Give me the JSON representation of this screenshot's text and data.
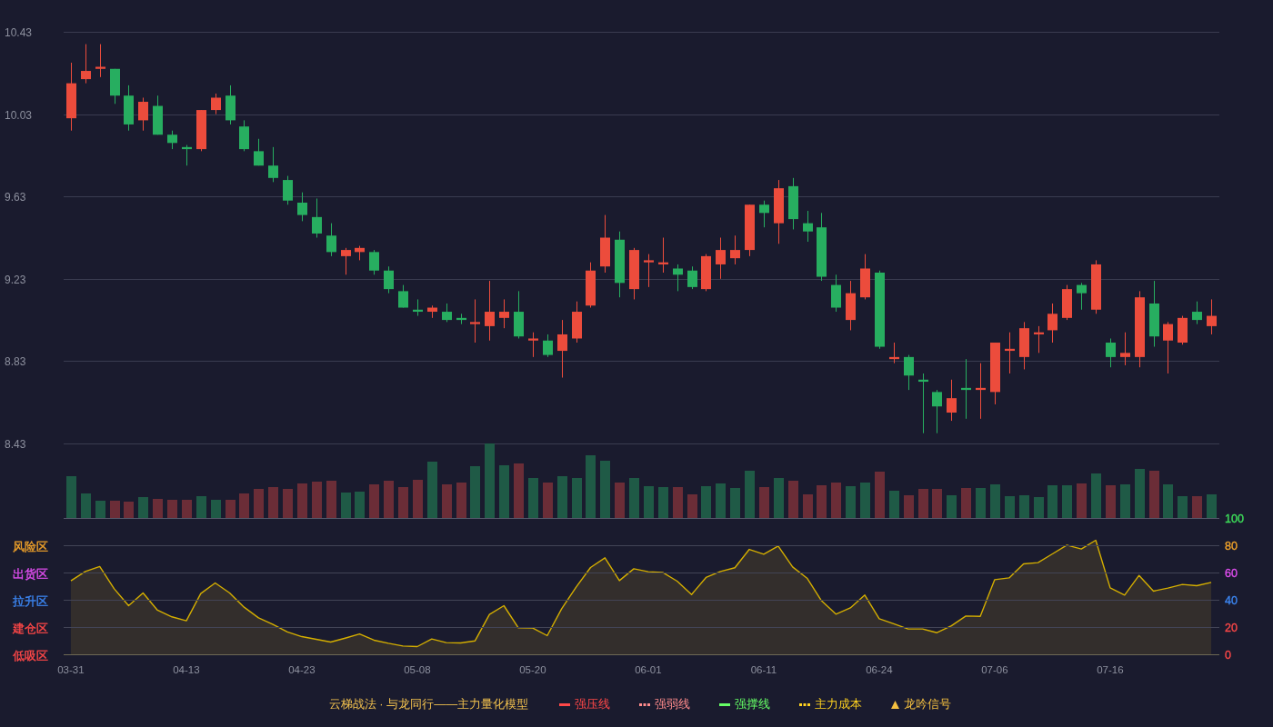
{
  "price_chart": {
    "chart_data": {
      "type": "candlestick",
      "categories": [
        null,
        null,
        null,
        null,
        null,
        null,
        null,
        null,
        null,
        null,
        null,
        null,
        null,
        null,
        null,
        null,
        null,
        null,
        null,
        null,
        null,
        null,
        null,
        null,
        null,
        null,
        null,
        null,
        null,
        null,
        null,
        null,
        null,
        null,
        null,
        null,
        null,
        null,
        null,
        null,
        null,
        null,
        null,
        null,
        null,
        null,
        null,
        null,
        null,
        null,
        null,
        null,
        null,
        null,
        null,
        null,
        null,
        null,
        null,
        null,
        null,
        null,
        null,
        null,
        null,
        null,
        null,
        null,
        null,
        null,
        null,
        null,
        null,
        null,
        null,
        null,
        null,
        null,
        null,
        null
      ],
      "ylim": [
        8.43,
        10.43
      ],
      "yticks": [
        10.43,
        10.03,
        9.63,
        9.23,
        8.83,
        8.43
      ],
      "grid": true,
      "ohlc": [
        [
          10.01,
          10.28,
          9.95,
          10.18
        ],
        [
          10.2,
          10.37,
          10.18,
          10.24
        ],
        [
          10.25,
          10.37,
          10.21,
          10.26
        ],
        [
          10.25,
          10.25,
          10.08,
          10.12
        ],
        [
          10.12,
          10.17,
          9.95,
          9.98
        ],
        [
          10.0,
          10.11,
          9.95,
          10.09
        ],
        [
          10.07,
          10.12,
          9.93,
          9.93
        ],
        [
          9.93,
          9.95,
          9.86,
          9.89
        ],
        [
          9.87,
          9.88,
          9.78,
          9.86
        ],
        [
          9.86,
          10.05,
          9.85,
          10.05
        ],
        [
          10.05,
          10.13,
          10.03,
          10.11
        ],
        [
          10.12,
          10.17,
          9.98,
          10.0
        ],
        [
          9.97,
          10.0,
          9.85,
          9.86
        ],
        [
          9.85,
          9.91,
          9.78,
          9.78
        ],
        [
          9.78,
          9.87,
          9.7,
          9.72
        ],
        [
          9.71,
          9.73,
          9.59,
          9.61
        ],
        [
          9.6,
          9.65,
          9.51,
          9.54
        ],
        [
          9.53,
          9.62,
          9.43,
          9.45
        ],
        [
          9.44,
          9.5,
          9.34,
          9.36
        ],
        [
          9.34,
          9.38,
          9.25,
          9.37
        ],
        [
          9.36,
          9.39,
          9.32,
          9.38
        ],
        [
          9.36,
          9.37,
          9.25,
          9.27
        ],
        [
          9.27,
          9.29,
          9.16,
          9.18
        ],
        [
          9.17,
          9.2,
          9.09,
          9.09
        ],
        [
          9.08,
          9.13,
          9.05,
          9.07
        ],
        [
          9.07,
          9.1,
          9.04,
          9.09
        ],
        [
          9.07,
          9.11,
          9.02,
          9.03
        ],
        [
          9.04,
          9.06,
          9.01,
          9.03
        ],
        [
          9.01,
          9.13,
          8.92,
          9.02
        ],
        [
          9.0,
          9.22,
          8.93,
          9.07
        ],
        [
          9.04,
          9.13,
          8.99,
          9.07
        ],
        [
          9.07,
          9.17,
          8.94,
          8.95
        ],
        [
          8.93,
          8.97,
          8.85,
          8.94
        ],
        [
          8.93,
          8.96,
          8.85,
          8.86
        ],
        [
          8.88,
          9.03,
          8.75,
          8.96
        ],
        [
          8.94,
          9.12,
          8.92,
          9.07
        ],
        [
          9.1,
          9.31,
          9.09,
          9.27
        ],
        [
          9.29,
          9.54,
          9.26,
          9.43
        ],
        [
          9.42,
          9.46,
          9.14,
          9.21
        ],
        [
          9.18,
          9.38,
          9.13,
          9.37
        ],
        [
          9.31,
          9.35,
          9.19,
          9.32
        ],
        [
          9.3,
          9.43,
          9.26,
          9.31
        ],
        [
          9.28,
          9.3,
          9.17,
          9.25
        ],
        [
          9.27,
          9.29,
          9.18,
          9.19
        ],
        [
          9.18,
          9.35,
          9.17,
          9.34
        ],
        [
          9.3,
          9.43,
          9.23,
          9.37
        ],
        [
          9.33,
          9.44,
          9.3,
          9.37
        ],
        [
          9.37,
          9.59,
          9.34,
          9.59
        ],
        [
          9.59,
          9.61,
          9.48,
          9.55
        ],
        [
          9.5,
          9.71,
          9.4,
          9.67
        ],
        [
          9.68,
          9.72,
          9.47,
          9.52
        ],
        [
          9.5,
          9.56,
          9.41,
          9.46
        ],
        [
          9.48,
          9.55,
          9.22,
          9.24
        ],
        [
          9.2,
          9.25,
          9.07,
          9.09
        ],
        [
          9.03,
          9.22,
          8.98,
          9.16
        ],
        [
          9.14,
          9.35,
          9.13,
          9.28
        ],
        [
          9.26,
          9.27,
          8.89,
          8.9
        ],
        [
          8.84,
          8.92,
          8.82,
          8.85
        ],
        [
          8.85,
          8.86,
          8.69,
          8.76
        ],
        [
          8.74,
          8.77,
          8.48,
          8.73
        ],
        [
          8.68,
          8.69,
          8.48,
          8.61
        ],
        [
          8.58,
          8.74,
          8.54,
          8.65
        ],
        [
          8.7,
          8.84,
          8.55,
          8.69
        ],
        [
          8.69,
          8.82,
          8.55,
          8.7
        ],
        [
          8.68,
          8.92,
          8.62,
          8.92
        ],
        [
          8.88,
          8.97,
          8.77,
          8.89
        ],
        [
          8.85,
          9.02,
          8.79,
          8.99
        ],
        [
          8.96,
          9.0,
          8.87,
          8.97
        ],
        [
          8.98,
          9.11,
          8.92,
          9.06
        ],
        [
          9.04,
          9.2,
          9.03,
          9.18
        ],
        [
          9.2,
          9.21,
          9.08,
          9.16
        ],
        [
          9.08,
          9.32,
          9.06,
          9.3
        ],
        [
          8.92,
          8.94,
          8.8,
          8.85
        ],
        [
          8.85,
          8.97,
          8.81,
          8.87
        ],
        [
          8.85,
          9.17,
          8.8,
          9.14
        ],
        [
          9.11,
          9.22,
          8.9,
          8.95
        ],
        [
          8.93,
          9.02,
          8.77,
          9.01
        ],
        [
          8.92,
          9.05,
          8.91,
          9.04
        ],
        [
          9.07,
          9.12,
          9.01,
          9.03
        ],
        [
          9.0,
          9.13,
          8.96,
          9.05
        ]
      ]
    }
  },
  "indicator": {
    "zones": [
      {
        "label": "风险区",
        "color": "#f2a32a"
      },
      {
        "label": "出货区",
        "color": "#e04ef0"
      },
      {
        "label": "拉升区",
        "color": "#3c86f2"
      },
      {
        "label": "建仓区",
        "color": "#ff4848"
      },
      {
        "label": "低吸区",
        "color": "#ff4848"
      }
    ],
    "right_axis": [
      {
        "color": "#3ee05a"
      },
      {
        "color": "#f2a32a"
      },
      {
        "color": "#e04ef0"
      },
      {
        "color": "#3c86f2"
      },
      {
        "color": "#ff4848"
      },
      {
        "color": "#ff4848"
      }
    ],
    "chart_data": {
      "type": "area",
      "categories": [
        "03-31",
        null,
        null,
        null,
        null,
        null,
        null,
        null,
        "04-13",
        null,
        null,
        null,
        null,
        null,
        null,
        null,
        "04-23",
        null,
        null,
        null,
        null,
        null,
        null,
        null,
        "05-08",
        null,
        null,
        null,
        null,
        null,
        null,
        null,
        "05-20",
        null,
        null,
        null,
        null,
        null,
        null,
        null,
        "06-01",
        null,
        null,
        null,
        null,
        null,
        null,
        null,
        "06-11",
        null,
        null,
        null,
        null,
        null,
        null,
        null,
        "06-24",
        null,
        null,
        null,
        null,
        null,
        null,
        null,
        "07-06",
        null,
        null,
        null,
        null,
        null,
        null,
        null,
        "07-16",
        null,
        null,
        null,
        null,
        null,
        null,
        null
      ],
      "ylim": [
        0,
        100
      ],
      "yticks": [
        {
          "value": 100,
          "label": "100"
        },
        {
          "value": 80,
          "label": "80"
        },
        {
          "value": 60,
          "label": "60"
        },
        {
          "value": 40,
          "label": "40"
        },
        {
          "value": 20,
          "label": "20"
        },
        {
          "value": 0,
          "label": "0"
        }
      ],
      "grid": true,
      "series": [
        {
          "color": "#d4ae00",
          "values": [
            54.2,
            61.1,
            64.7,
            48.4,
            36,
            45.3,
            32.7,
            27.8,
            24.9,
            44.9,
            52.7,
            45.3,
            34.9,
            27.1,
            22.2,
            16.7,
            13.3,
            11.3,
            9.3,
            12.2,
            15.3,
            10.7,
            8.4,
            6.4,
            6,
            11.6,
            8.9,
            8.7,
            10.2,
            29.6,
            36,
            19.8,
            19.6,
            14,
            33.8,
            49.6,
            64,
            71.1,
            54.4,
            63.1,
            60.9,
            60.4,
            54,
            44.2,
            56.7,
            61.1,
            63.8,
            77.3,
            73.8,
            79.8,
            64.4,
            56.2,
            39.6,
            29.8,
            34.4,
            43.8,
            26.4,
            22.7,
            18.9,
            18.9,
            16.2,
            21.3,
            28.4,
            28.2,
            55.1,
            56.4,
            66.7,
            67.6,
            74,
            80.4,
            77.6,
            84,
            49.1,
            43.8,
            58.2,
            46.7,
            48.9,
            51.6,
            50.7,
            53.1
          ]
        }
      ]
    }
  },
  "legend": {
    "title": "云梯战法 · 与龙同行——主力量化模型",
    "items": [
      {
        "label": "强压线",
        "kind": "line",
        "color": "#ff4848"
      },
      {
        "label": "强弱线",
        "kind": "dashed",
        "color": "#ff8c8c"
      },
      {
        "label": "强撑线",
        "kind": "line",
        "color": "#66ff66"
      },
      {
        "label": "主力成本",
        "kind": "dashed",
        "color": "#ffd21f"
      },
      {
        "label": "龙吟信号",
        "kind": "triangle",
        "color": "#f5c040"
      }
    ]
  }
}
